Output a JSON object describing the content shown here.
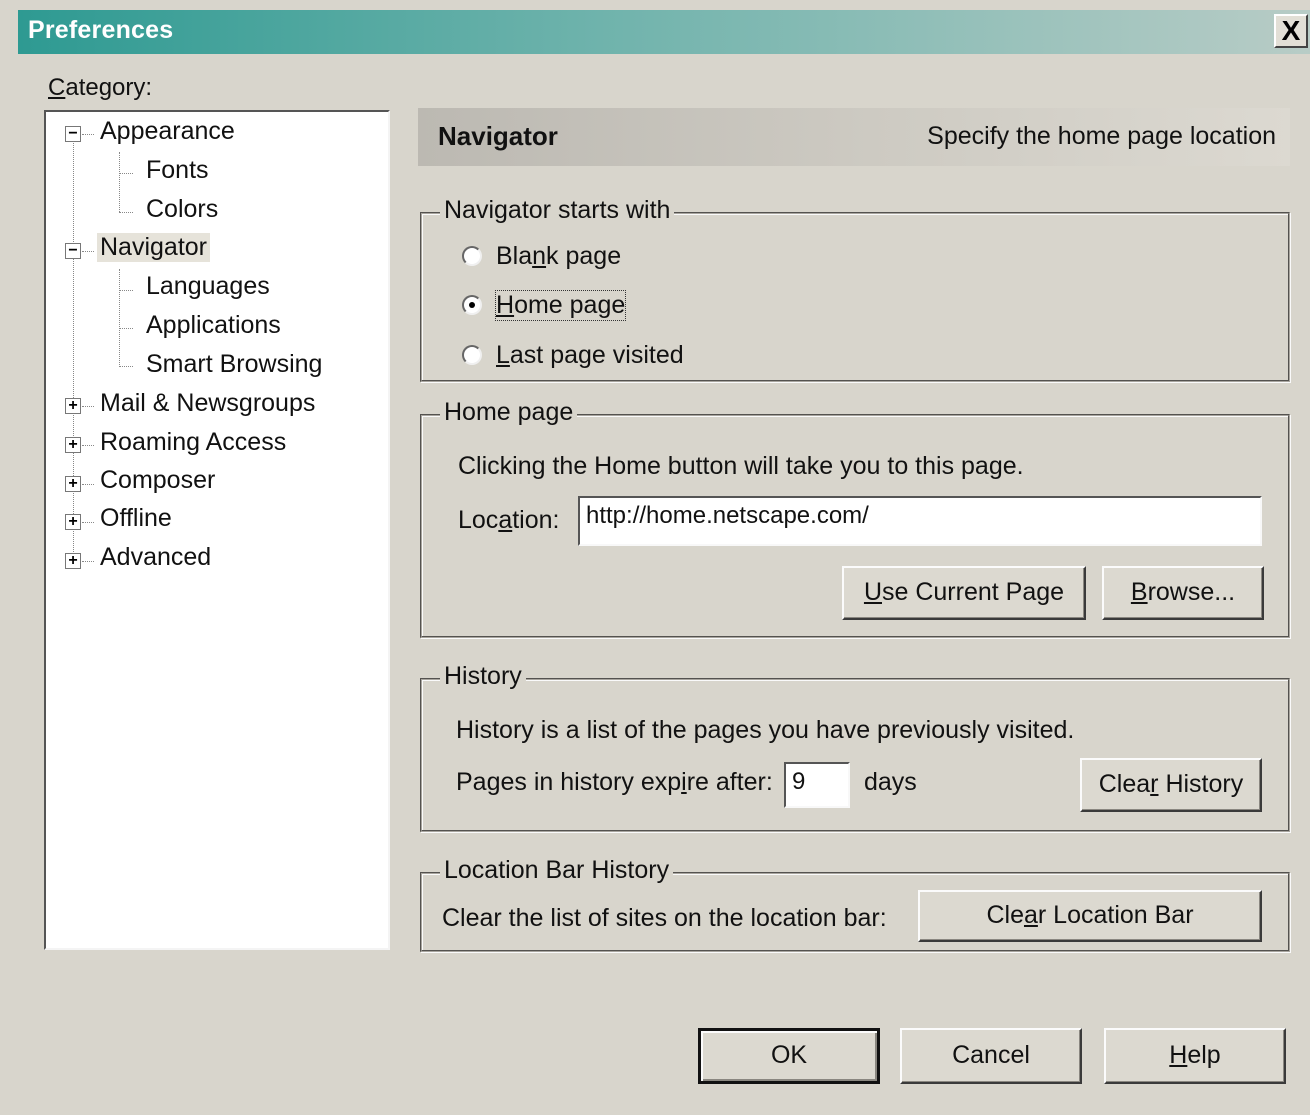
{
  "window": {
    "title": "Preferences",
    "close_label": "X"
  },
  "category": {
    "label_prefix": "C",
    "label_rest": "ategory:"
  },
  "tree": {
    "appearance": "Appearance",
    "fonts": "Fonts",
    "colors": "Colors",
    "navigator": "Navigator",
    "languages": "Languages",
    "applications": "Applications",
    "smart_browsing": "Smart Browsing",
    "mail": "Mail & Newsgroups",
    "roaming": "Roaming Access",
    "composer": "Composer",
    "offline": "Offline",
    "advanced": "Advanced",
    "collapse_symbol": "−",
    "expand_symbol": "+"
  },
  "header": {
    "title": "Navigator",
    "description": "Specify the home page location"
  },
  "starts_with": {
    "legend": "Navigator starts with",
    "options": [
      {
        "pre": "Bla",
        "acc": "n",
        "post": "k page",
        "checked": false
      },
      {
        "pre": "",
        "acc": "H",
        "post": "ome page",
        "checked": true
      },
      {
        "pre": "",
        "acc": "L",
        "post": "ast page visited",
        "checked": false
      }
    ]
  },
  "home_page": {
    "legend": "Home page",
    "description": "Clicking the Home button will take you to this page.",
    "location_pre": "Loc",
    "location_acc": "a",
    "location_post": "tion:",
    "location_value": "http://home.netscape.com/",
    "use_current_acc": "U",
    "use_current_rest": "se Current Page",
    "browse_acc": "B",
    "browse_rest": "rowse..."
  },
  "history": {
    "legend": "History",
    "description": "History is a list of the pages you have previously visited.",
    "expire_pre": "Pages in history exp",
    "expire_acc": "i",
    "expire_post": "re after:",
    "days_value": "9",
    "days_label": "days",
    "clear_pre": "Clea",
    "clear_acc": "r",
    "clear_post": " History"
  },
  "location_bar": {
    "legend": "Location Bar History",
    "description": "Clear the list of sites on the location bar:",
    "clear_pre": "Cle",
    "clear_acc": "a",
    "clear_post": "r Location Bar"
  },
  "buttons": {
    "ok": "OK",
    "cancel": "Cancel",
    "help_acc": "H",
    "help_rest": "elp"
  }
}
